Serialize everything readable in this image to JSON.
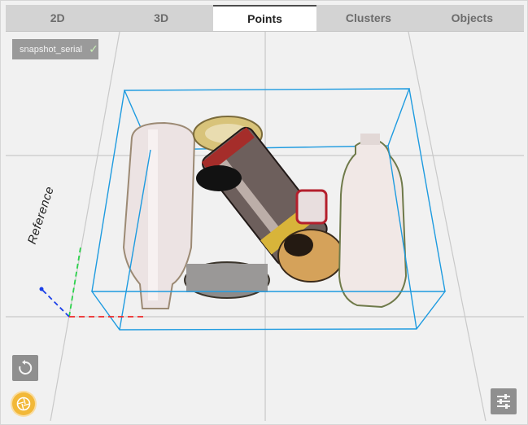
{
  "tabs": [
    {
      "label": "2D",
      "active": false
    },
    {
      "label": "3D",
      "active": false
    },
    {
      "label": "Points",
      "active": true
    },
    {
      "label": "Clusters",
      "active": false
    },
    {
      "label": "Objects",
      "active": false
    }
  ],
  "snapshot": {
    "label": "snapshot_serial",
    "status_icon": "check-icon"
  },
  "scene": {
    "reference_label": "Reference",
    "bbox_color": "#1e9be0"
  },
  "controls": {
    "reset_icon": "rotate-ccw-icon",
    "snapshot_icon": "aperture-icon",
    "settings_icon": "sliders-icon"
  }
}
